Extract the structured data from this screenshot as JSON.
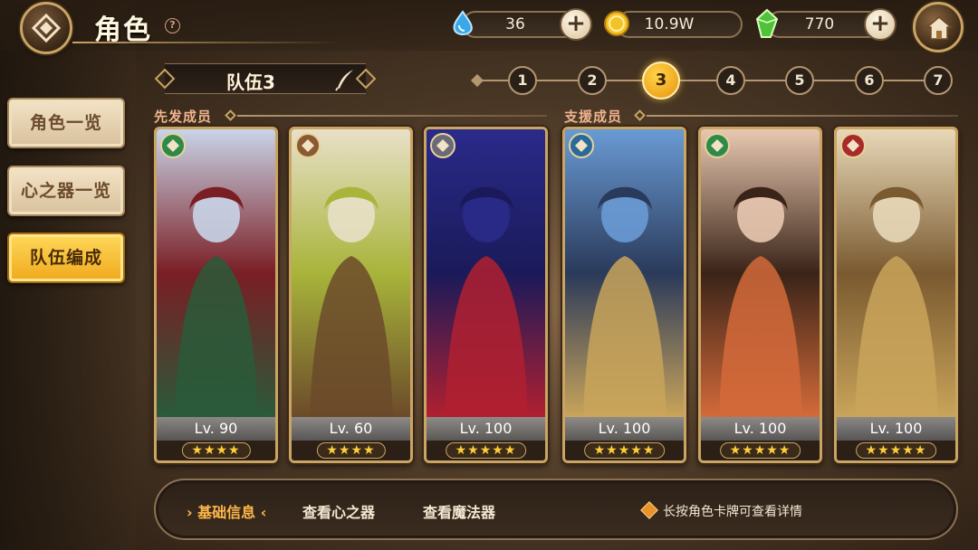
{
  "header": {
    "title": "角色",
    "help_symbol": "?"
  },
  "resources": [
    {
      "name": "water-crystal",
      "icon": "water-drop-icon",
      "value": "36",
      "add": "+"
    },
    {
      "name": "gold",
      "icon": "gold-coin-icon",
      "value": "10.9W",
      "add": "+"
    },
    {
      "name": "green-gem",
      "icon": "green-gem-icon",
      "value": "770",
      "add": "+"
    }
  ],
  "sidebar": {
    "items": [
      {
        "label": "角色一览",
        "active": false
      },
      {
        "label": "心之器一览",
        "active": false
      },
      {
        "label": "队伍编成",
        "active": true
      }
    ]
  },
  "team": {
    "name": "队伍3",
    "pages": [
      "1",
      "2",
      "3",
      "4",
      "5",
      "6",
      "7"
    ],
    "active_page": "3"
  },
  "sections": {
    "starters": "先发成员",
    "support": "支援成员"
  },
  "cards": [
    {
      "level": "Lv. 90",
      "stars": "★★★★",
      "element": "wind",
      "element_color": "#2f8a4a",
      "palette": [
        "#7a1e24",
        "#2a5a3a",
        "#c9d4e8"
      ]
    },
    {
      "level": "Lv. 60",
      "stars": "★★★★",
      "element": "earth",
      "element_color": "#8a5a30",
      "palette": [
        "#a8b43a",
        "#6b4a2a",
        "#e8e0c8"
      ]
    },
    {
      "level": "Lv. 100",
      "stars": "★★★★★",
      "element": "neutral",
      "element_color": "#6a6a78",
      "palette": [
        "#1a1a5a",
        "#b02030",
        "#2a2a8a"
      ]
    },
    {
      "level": "Lv. 100",
      "stars": "★★★★★",
      "element": "water",
      "element_color": "#2a6a9a",
      "palette": [
        "#2a3a5a",
        "#c9a45a",
        "#6a9ad4"
      ]
    },
    {
      "level": "Lv. 100",
      "stars": "★★★★★",
      "element": "wind",
      "element_color": "#2f8a4a",
      "palette": [
        "#3a2418",
        "#d46a3a",
        "#e8c8b0"
      ]
    },
    {
      "level": "Lv. 100",
      "stars": "★★★★★",
      "element": "fire",
      "element_color": "#a82a2a",
      "palette": [
        "#7a5a30",
        "#c9a45a",
        "#e8d8b8"
      ]
    }
  ],
  "bottom_bar": {
    "tabs": [
      {
        "label": "基础信息",
        "active": true
      },
      {
        "label": "查看心之器",
        "active": false
      },
      {
        "label": "查看魔法器",
        "active": false
      }
    ],
    "tip": "长按角色卡牌可查看详情"
  },
  "colors": {
    "accent_gold": "#c9a463",
    "active_orange": "#f0a91c",
    "section_text": "#f0b48e"
  }
}
